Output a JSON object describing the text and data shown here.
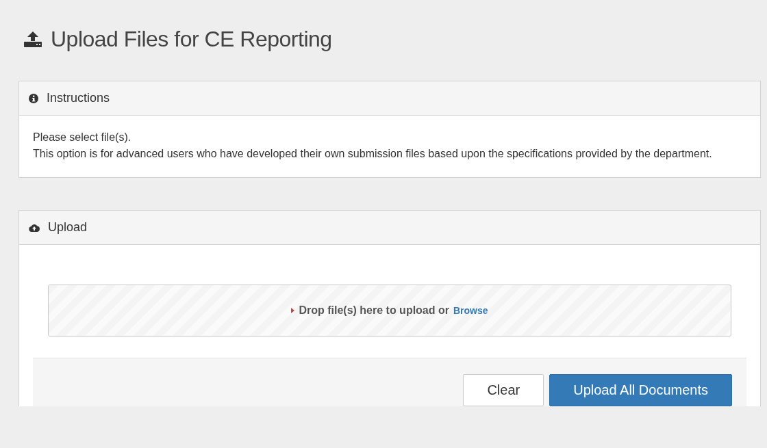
{
  "page_title": "Upload Files for CE Reporting",
  "instructions": {
    "heading": "Instructions",
    "lines": [
      "Please select file(s).",
      "This option is for advanced users who have developed their own submission files based upon the specifications provided by the department."
    ]
  },
  "upload": {
    "heading": "Upload",
    "drop_text": "Drop file(s) here to upload or",
    "browse_link": "Browse",
    "buttons": [
      {
        "label": "Clear",
        "kind": "default"
      },
      {
        "label": "Upload All Documents",
        "kind": "primary"
      }
    ]
  }
}
